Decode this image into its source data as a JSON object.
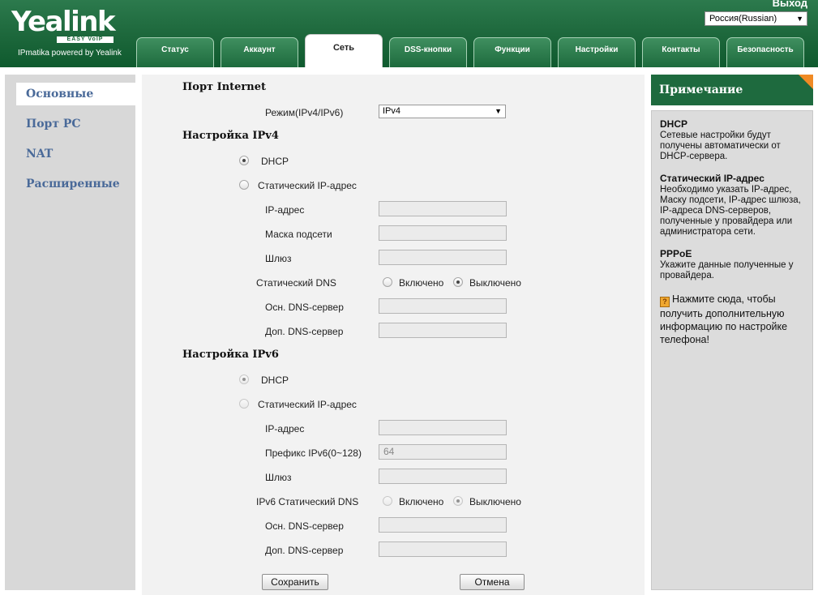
{
  "header": {
    "logo": "Yealink",
    "logo_sub": "EASY VoIP",
    "powered": "IPmatika powered by Yealink",
    "logout": "Выход",
    "language": "Россия(Russian)"
  },
  "tabs": [
    {
      "label": "Статус"
    },
    {
      "label": "Аккаунт"
    },
    {
      "label": "Сеть"
    },
    {
      "label": "DSS-кнопки"
    },
    {
      "label": "Функции"
    },
    {
      "label": "Настройки"
    },
    {
      "label": "Контакты"
    },
    {
      "label": "Безопасность"
    }
  ],
  "active_tab": "Сеть",
  "sidebar": {
    "items": [
      {
        "label": "Основные"
      },
      {
        "label": "Порт PC"
      },
      {
        "label": "NAT"
      },
      {
        "label": "Расширенные"
      }
    ],
    "active": "Основные"
  },
  "form": {
    "internet_port": "Порт Internet",
    "mode_label": "Режим(IPv4/IPv6)",
    "mode_value": "IPv4",
    "ipv4": {
      "title": "Настройка IPv4",
      "dhcp": "DHCP",
      "static_ip": "Статический IP-адрес",
      "ip_address": "IP-адрес",
      "subnet_mask": "Маска подсети",
      "gateway": "Шлюз",
      "static_dns": "Статический DNS",
      "enabled": "Включено",
      "disabled": "Выключено",
      "primary_dns": "Осн. DNS-сервер",
      "secondary_dns": "Доп. DNS-сервер"
    },
    "ipv6": {
      "title": "Настройка IPv6",
      "dhcp": "DHCP",
      "static_ip": "Статический IP-адрес",
      "ip_address": "IP-адрес",
      "prefix": "Префикс IPv6(0~128)",
      "prefix_value": "64",
      "gateway": "Шлюз",
      "static_dns": "IPv6 Статический DNS",
      "enabled": "Включено",
      "disabled": "Выключено",
      "primary_dns": "Осн. DNS-сервер",
      "secondary_dns": "Доп. DNS-сервер"
    },
    "save": "Сохранить",
    "cancel": "Отмена"
  },
  "note": {
    "title": "Примечание",
    "dhcp_title": "DHCP",
    "dhcp_text": "Сетевые настройки будут получены автоматически от DHCP-сервера.",
    "static_title": "Статический IP-адрес",
    "static_text": "Необходимо указать IP-адрес, Маску подсети, IP-адрес шлюза, IP-адреса DNS-серверов, полученные у провайдера или администратора сети.",
    "pppoe_title": "PPPoE",
    "pppoe_text": "Укажите данные полученные у провайдера.",
    "help_text": "Нажмите сюда, чтобы получить дополнительную информацию по настройке телефона!"
  },
  "colors": {
    "brand_green": "#1e6a3e",
    "nav_link": "#4a6a99",
    "note_corner": "#f08a24"
  }
}
